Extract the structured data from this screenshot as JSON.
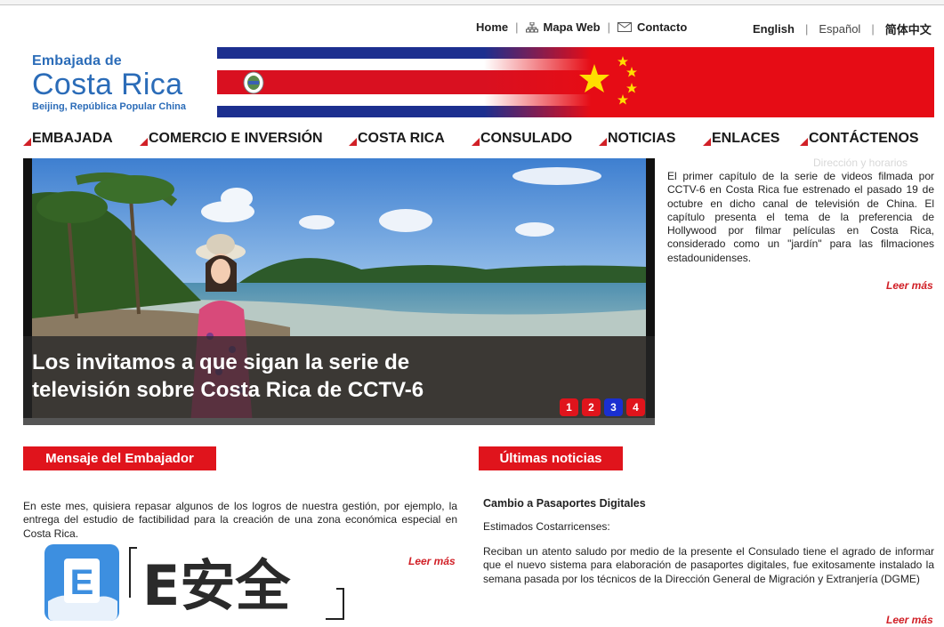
{
  "utility_nav": {
    "home": "Home",
    "sitemap": "Mapa Web",
    "contact": "Contacto",
    "lang_en": "English",
    "lang_es": "Español",
    "lang_zh": "简体中文",
    "separator": "|"
  },
  "logo": {
    "line1": "Embajada de",
    "line2": "Costa Rica",
    "line3": "Beijing, República Popular China"
  },
  "main_nav": [
    "EMBAJADA",
    "COMERCIO E INVERSIÓN",
    "COSTA RICA",
    "CONSULADO",
    "NOTICIAS",
    "ENLACES",
    "CONTÁCTENOS"
  ],
  "slider": {
    "caption": "Los invitamos a que sigan la serie de televisión sobre Costa Rica de CCTV-6",
    "pages": [
      "1",
      "2",
      "3",
      "4"
    ],
    "active_page": "3"
  },
  "featured": {
    "faded_link": "Dirección y horarios",
    "text": "El primer capítulo de la serie de videos filmada por CCTV-6 en Costa Rica fue estrenado el pasado 19 de octubre en dicho canal de televisión de China. El capítulo presenta el tema de la preferencia de Hollywood por filmar películas en Costa Rica, considerado como un \"jardín\" para las filmaciones estadounidenses.",
    "read_more": "Leer más"
  },
  "ambassador": {
    "heading": "Mensaje del Embajador",
    "text": "En este mes, quisiera repasar algunos de los logros de nuestra gestión, por ejemplo, la entrega del estudio de factibilidad para la creación de una zona económica especial en Costa Rica.",
    "read_more": "Leer más"
  },
  "news": {
    "heading": "Últimas noticias",
    "title": "Cambio a Pasaportes Digitales",
    "greeting": "Estimados Costarricenses:",
    "text": "Reciban un atento saludo por medio de la presente el Consulado tiene el agrado de informar que el nuevo sistema para elaboración de pasaportes digitales, fue exitosamente instalado la semana pasada por los técnicos de la Dirección General de Migración y Extranjería (DGME)",
    "read_more": "Leer más"
  },
  "watermark": {
    "badge_letter": "E",
    "text": "E安全"
  },
  "colors": {
    "accent_red": "#e0141c",
    "link_red": "#d12027",
    "logo_blue": "#2b6cb8",
    "active_dot": "#1a2fd0"
  }
}
